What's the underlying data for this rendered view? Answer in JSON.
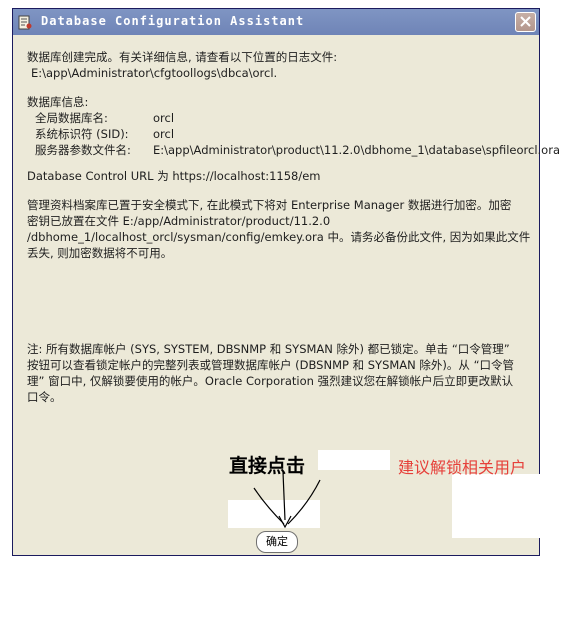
{
  "window": {
    "title": "Database Configuration Assistant",
    "icons": {
      "app": "dbca-app-icon",
      "close": "close-icon"
    }
  },
  "content": {
    "creation_done": "数据库创建完成。有关详细信息, 请查看以下位置的日志文件:",
    "log_path": "E:\\app\\Administrator\\cfgtoollogs\\dbca\\orcl.",
    "db_info_heading": "数据库信息:",
    "rows": [
      {
        "label": "全局数据库名:",
        "value": "orcl"
      },
      {
        "label": "系统标识符 (SID):",
        "value": "orcl"
      },
      {
        "label": "服务器参数文件名:",
        "value": "E:\\app\\Administrator\\product\\11.2.0\\dbhome_1\\database\\spfileorcl.ora"
      }
    ],
    "control_url": "Database Control URL 为 https://localhost:1158/em",
    "repo_lines": [
      "管理资料档案库已置于安全模式下, 在此模式下将对 Enterprise Manager 数据进行加密。加密",
      "密钥已放置在文件 E:/app/Administrator/product/11.2.0",
      "/dbhome_1/localhost_orcl/sysman/config/emkey.ora 中。请务必备份此文件, 因为如果此文件",
      "丢失, 则加密数据将不可用。"
    ],
    "note_lines": [
      "注: 所有数据库帐户 (SYS, SYSTEM, DBSNMP 和 SYSMAN 除外) 都已锁定。单击 “口令管理”",
      "按钮可以查看锁定帐户的完整列表或管理数据库帐户 (DBSNMP 和 SYSMAN 除外)。从 “口令管",
      "理” 窗口中, 仅解锁要使用的帐户。Oracle Corporation 强烈建议您在解锁帐户后立即更改默认",
      "口令。"
    ]
  },
  "annotations": {
    "click_directly": "直接点击",
    "suggest_unlock": "建议解锁相关用户"
  },
  "buttons": {
    "ok_label": "确定"
  },
  "colors": {
    "dialog_bg": "#ece9d8",
    "titlebar": "#7388ba",
    "annotation_red": "#e6403a"
  }
}
